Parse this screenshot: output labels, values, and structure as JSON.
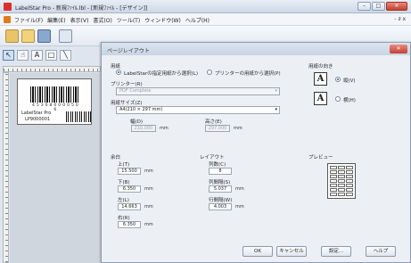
{
  "window": {
    "title": "LabelStar Pro - 新規ﾌｧｲﾙ.lbl - [新規ﾌｧｲﾙ - [デザイン]]",
    "minimize": "–",
    "maximize": "□",
    "close": "✕"
  },
  "menubar": {
    "items": [
      "ファイル(F)",
      "編集(E)",
      "表示(V)",
      "書式(O)",
      "ツール(T)",
      "ウィンドウ(W)",
      "ヘルプ(H)"
    ],
    "right": "- ∂ x"
  },
  "palette": {
    "tools": [
      "↖",
      "☝",
      "A",
      "□",
      "╲"
    ]
  },
  "label_preview": {
    "barcode_number": "4 5 3 0 8 0 0 0 0 5 0 6",
    "name": "LabelStar Pro",
    "code": "LP9000001"
  },
  "dialog": {
    "title": "ページレイアウト",
    "close": "✕",
    "paper_section": "用紙",
    "radio_labelstar": "LabelStarの指定用紙から選択(L)",
    "radio_printer": "プリンターの用紙から選択(P)",
    "printer_label": "プリンター(R)",
    "printer_value": "PDF Complete",
    "size_label": "用紙サイズ(Z)",
    "size_value": "A4(210 × 297 mm)",
    "width_label": "幅(D)",
    "width_value": "210.000",
    "height_label": "高さ(E)",
    "height_value": "297.000",
    "unit": "mm",
    "orientation_label": "用紙の向き",
    "portrait": "縦(V)",
    "landscape": "横(H)",
    "orientation_glyph": "A",
    "margin_section": "余白",
    "top_label": "上(T)",
    "top_value": "15.500",
    "bottom_label": "下(B)",
    "bottom_value": "6.350",
    "left_label": "左(L)",
    "left_value": "14.663",
    "right_label": "右(R)",
    "right_value": "6.350",
    "layout_section": "レイアウト",
    "columns_label": "列数(C)",
    "columns_value": "8",
    "col_gap_label": "列間隔(S)",
    "col_gap_value": "5.037",
    "row_gap_label": "行間隔(W)",
    "row_gap_value": "4.003",
    "preview_label": "プレビュー",
    "ok": "OK",
    "cancel": "キャンセル",
    "settings": "設定...",
    "help": "ヘルプ"
  }
}
